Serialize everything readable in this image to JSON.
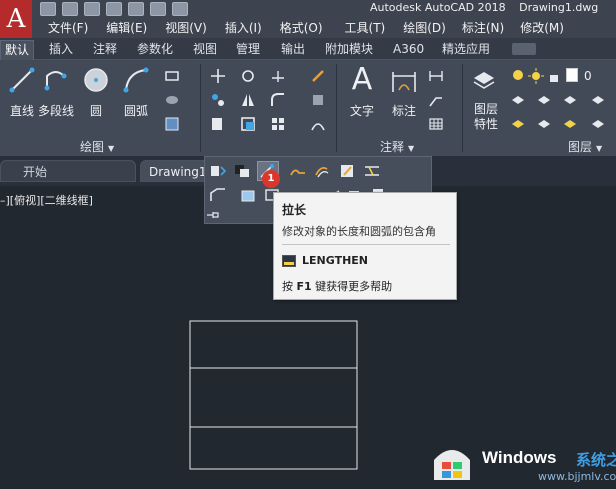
{
  "app": {
    "logo": "A",
    "title": "Autodesk AutoCAD 2018",
    "doc_title": "Drawing1.dwg"
  },
  "menubar": {
    "items": [
      "文件(F)",
      "编辑(E)",
      "视图(V)",
      "插入(I)",
      "格式(O)",
      "工具(T)",
      "绘图(D)",
      "标注(N)",
      "修改(M)"
    ]
  },
  "ribbon_tabs": {
    "items": [
      "默认",
      "插入",
      "注释",
      "参数化",
      "视图",
      "管理",
      "输出",
      "附加模块",
      "A360",
      "精选应用"
    ],
    "active": "默认"
  },
  "ribbon": {
    "draw_panel": {
      "line": "直线",
      "polyline": "多段线",
      "circle": "圆",
      "arc": "圆弧",
      "footer": "绘图"
    },
    "annotation_panel": {
      "text": "文字",
      "dimension": "标注",
      "footer": "注释"
    },
    "layers_panel": {
      "layer_props_1": "图层",
      "layer_props_2": "特性",
      "current_layer": "0",
      "footer": "图层"
    }
  },
  "doc_tabs": {
    "start": "开始",
    "drawing": "Drawing1"
  },
  "viewport": {
    "label": "–][俯视][二维线框]"
  },
  "flyout": {
    "badge": "1"
  },
  "tooltip": {
    "title": "拉长",
    "description": "修改对象的长度和圆弧的包含角",
    "command": "LENGTHEN",
    "help_pre": "按 ",
    "help_key": "F1",
    "help_post": " 键获得更多帮助"
  },
  "watermark": {
    "brand": "Windows",
    "sub": "系统之家",
    "url": "www.bjjmlv.com"
  },
  "colors": {
    "accent_red": "#d9372c",
    "watermark_blue": "#3da0e4"
  }
}
